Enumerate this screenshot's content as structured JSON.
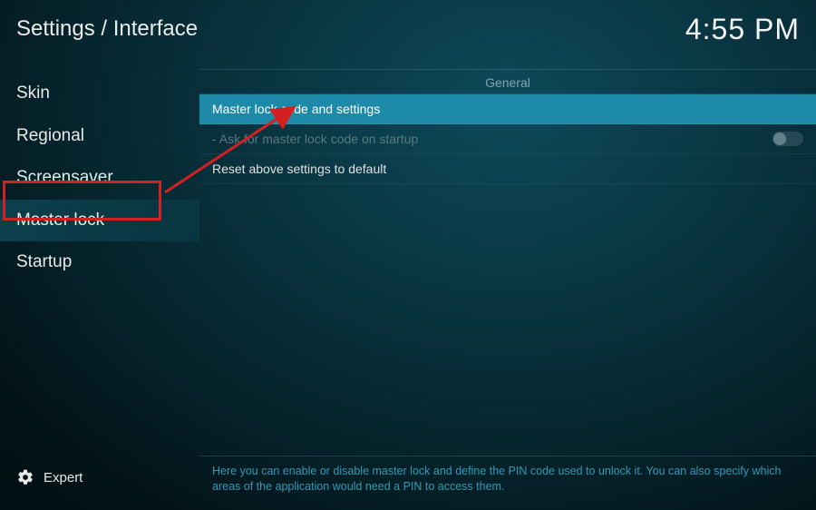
{
  "header": {
    "breadcrumb": "Settings / Interface",
    "clock": "4:55 PM"
  },
  "sidebar": {
    "items": [
      {
        "label": "Skin"
      },
      {
        "label": "Regional"
      },
      {
        "label": "Screensaver"
      },
      {
        "label": "Master lock"
      },
      {
        "label": "Startup"
      }
    ]
  },
  "content": {
    "section_title": "General",
    "rows": [
      {
        "label": "Master lock code and settings"
      },
      {
        "label": "- Ask for master lock code on startup"
      },
      {
        "label": "Reset above settings to default"
      }
    ]
  },
  "footer": {
    "level": "Expert",
    "help": "Here you can enable or disable master lock and define the PIN code used to unlock it. You can also specify which areas of the application would need a PIN to access them."
  },
  "annotation": {
    "highlight_color": "#d32020"
  }
}
